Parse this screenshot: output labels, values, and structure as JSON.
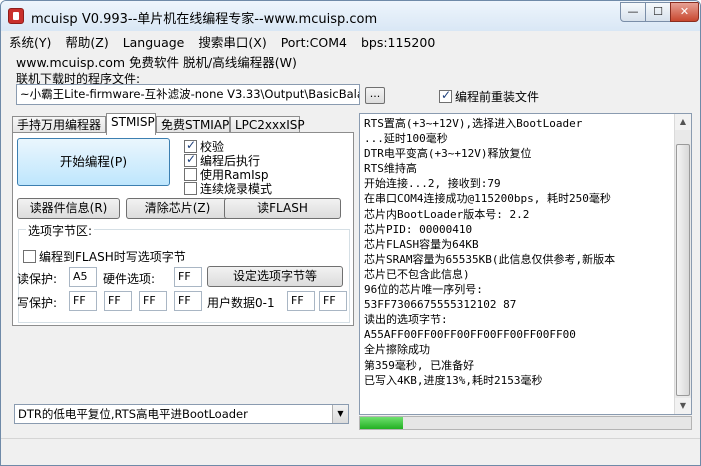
{
  "window": {
    "title": "mcuisp V0.993--单片机在线编程专家--www.mcuisp.com",
    "min": "—",
    "max": "☐",
    "close": "✕"
  },
  "menu": [
    "系统(Y)",
    "帮助(Z)",
    "Language",
    "搜索串口(X)",
    "Port:COM4",
    "bps:115200"
  ],
  "subtitle": "www.mcuisp.com 免费软件 脱机/高线编程器(W)",
  "file": {
    "label": "联机下载时的程序文件:",
    "path": "~小霸王Lite-firmware-互补滤波-none V3.33\\Output\\BasicBalance.hex",
    "browse": "...",
    "reload_label": "编程前重装文件",
    "reload_checked": true
  },
  "tabs": [
    "手持万用编程器",
    "STMISP",
    "免费STMIAP",
    "LPC2xxxISP"
  ],
  "panel": {
    "start_label": "开始编程(P)",
    "options": [
      {
        "label": "校验",
        "checked": true
      },
      {
        "label": "编程后执行",
        "checked": true
      },
      {
        "label": "使用RamIsp",
        "checked": false
      },
      {
        "label": "连续烧录模式",
        "checked": false
      }
    ],
    "read_info": "读器件信息(R)",
    "erase": "清除芯片(Z)",
    "read_flash": "读FLASH",
    "group_title": "选项字节区:",
    "flash_option_label": "编程到FLASH时写选项字节",
    "read_protect_label": "读保护:",
    "read_protect": "A5",
    "hw_option_label": "硬件选项:",
    "hw_option": "FF",
    "set_option": "设定选项字节等",
    "write_protect_label": "写保护:",
    "write_protect": [
      "FF",
      "FF",
      "FF",
      "FF"
    ],
    "user_data_label": "用户数据0-1",
    "user_data": [
      "FF",
      "FF"
    ]
  },
  "reset_mode": "DTR的低电平复位,RTS高电平进BootLoader",
  "log": [
    "RTS置高(+3~+12V),选择进入BootLoader",
    "...延时100毫秒",
    "DTR电平变高(+3~+12V)释放复位",
    "RTS维持高",
    "开始连接...2, 接收到:79",
    "在串口COM4连接成功@115200bps, 耗时250毫秒",
    "芯片内BootLoader版本号: 2.2",
    "芯片PID: 00000410",
    "芯片FLASH容量为64KB",
    "芯片SRAM容量为65535KB(此信息仅供参考,新版本",
    "芯片已不包含此信息)",
    "96位的芯片唯一序列号:",
    "53FF7306675555312102 87",
    "读出的选项字节:",
    "A55AFF00FF00FF00FF00FF00FF00FF00",
    "全片擦除成功",
    "第359毫秒, 已准备好",
    "已写入4KB,进度13%,耗时2153毫秒"
  ],
  "progress": 0.13,
  "colors": {
    "accent": "#3c7fb1",
    "progress": "#22b022",
    "close": "#c8482f"
  }
}
